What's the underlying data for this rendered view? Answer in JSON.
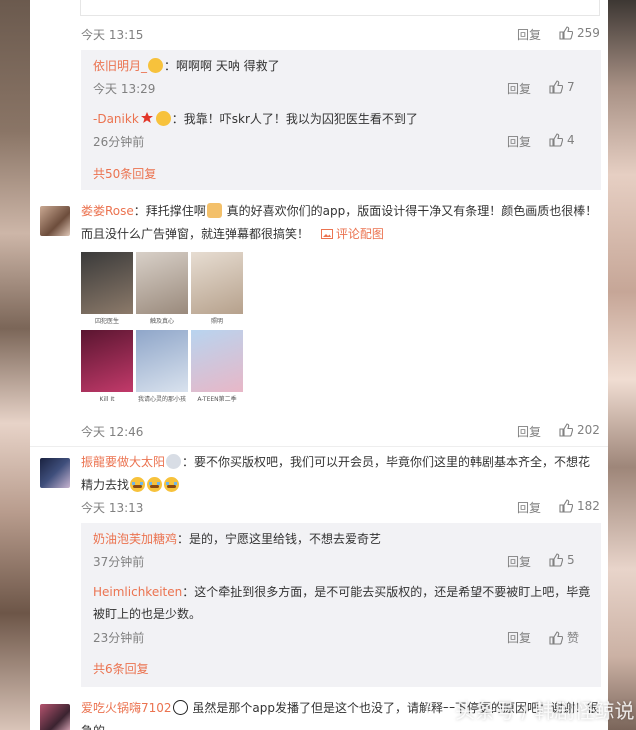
{
  "top_comment": {
    "time": "今天 13:15",
    "reply_label": "回复",
    "likes": "259",
    "sub_replies": [
      {
        "user": "依旧明月_",
        "text": "：啊啊啊 天呐 得救了",
        "time": "今天 13:29",
        "likes": "7"
      },
      {
        "user": "-Danikk",
        "text": "：我靠！吓skr人了！我以为囚犯医生看不到了",
        "time": "26分钟前",
        "likes": "4"
      }
    ],
    "more": "共50条回复"
  },
  "comment_rose": {
    "user": "娄娄Rose",
    "text_line1": "：拜托撑住啊",
    "text_line1b": " 真的好喜欢你们的app，版面设计得干净又有条理！颜色画质也很棒！",
    "text_line2": "而且没什么广告弹窗，就连弹幕都很搞笑！",
    "pic_link": "评论配图",
    "time": "今天 12:46",
    "reply_label": "回复",
    "likes": "202",
    "thumbs": [
      {
        "caption": "囚犯医生",
        "color1": "#3a3a3a",
        "color2": "#8c7a6a"
      },
      {
        "caption": "触及真心",
        "color1": "#d8d0c8",
        "color2": "#9a8a7c"
      },
      {
        "caption": "照明",
        "color1": "#e7ddd2",
        "color2": "#b6a18c"
      },
      {
        "caption": "Kill It",
        "color1": "#5a1530",
        "color2": "#c23a6a"
      },
      {
        "caption": "我请心灵的那小孩",
        "color1": "#8fa6c9",
        "color2": "#d9e2ee"
      },
      {
        "caption": "A-TEEN第二季",
        "color1": "#b8d4ef",
        "color2": "#e8b7c7"
      }
    ]
  },
  "comment_zhenlong": {
    "user": "振龍要做大太阳",
    "text_line1": "：要不你买版权吧，我们可以开会员，毕竟你们这里的韩剧基本齐全，不想花",
    "text_line2": "精力去找",
    "time": "今天 13:13",
    "reply_label": "回复",
    "likes": "182",
    "sub_replies": [
      {
        "user": "奶油泡芙加糖鸡",
        "text": "：是的，宁愿这里给钱，不想去爱奇艺",
        "time": "37分钟前",
        "likes": "5"
      },
      {
        "user": "Heimlichkeiten",
        "text": "：这个牵扯到很多方面，是不可能去买版权的，还是希望不要被盯上吧，毕竟",
        "text2": "被盯上的也是少数。",
        "time": "23分钟前",
        "likes": "赞"
      }
    ],
    "more": "共6条回复"
  },
  "comment_last": {
    "user": "爱吃火锅嗨7102",
    "text_line1": " 虽然是那个app发播了但是这个也没了，请解释一下停更的原因吧！谢谢！很",
    "text_line2": "急的"
  },
  "watermark": "头条号 / 韩剧怪鲸说",
  "colors": {
    "accent": "#eb7350",
    "sub_bg": "#f2f2f5",
    "meta": "#808080"
  }
}
